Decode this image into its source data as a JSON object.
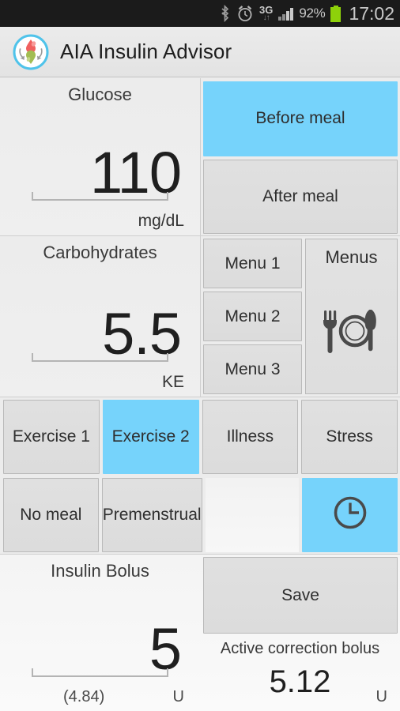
{
  "statusbar": {
    "icons": [
      "bluetooth-icon",
      "alarm-icon",
      "3g-icon",
      "signal-icon",
      "battery-icon"
    ],
    "network_label": "3G",
    "battery_percent": "92%",
    "clock": "17:02"
  },
  "titlebar": {
    "app_name": "AIA Insulin Advisor",
    "icon": "aia-app-logo"
  },
  "glucose": {
    "label": "Glucose",
    "value": "110",
    "unit": "mg/dL"
  },
  "meal_state": {
    "before_label": "Before meal",
    "after_label": "After meal",
    "selected": "Before meal"
  },
  "carbohydrates": {
    "label": "Carbohydrates",
    "value": "5.5",
    "unit": "KE"
  },
  "menu_buttons": [
    {
      "label": "Menu 1"
    },
    {
      "label": "Menu 2"
    },
    {
      "label": "Menu 3"
    }
  ],
  "menus_panel": {
    "title": "Menus",
    "icon": "cutlery-icon"
  },
  "factor_row": [
    {
      "label": "Exercise 1",
      "selected": false
    },
    {
      "label": "Exercise 2",
      "selected": true
    },
    {
      "label": "Illness",
      "selected": false
    },
    {
      "label": "Stress",
      "selected": false
    }
  ],
  "state_row": [
    {
      "label": "No meal",
      "selected": false
    },
    {
      "label": "Premenstrual",
      "selected": false
    },
    {
      "label": "",
      "selected": false
    },
    {
      "label": "",
      "selected": true,
      "icon": "clock-icon"
    }
  ],
  "insulin_bolus": {
    "label": "Insulin Bolus",
    "value": "5",
    "computed": "(4.84)",
    "unit": "U"
  },
  "save": {
    "label": "Save"
  },
  "active_correction": {
    "label": "Active correction bolus",
    "value": "5.12",
    "unit": "U"
  },
  "colors": {
    "accent_selected": "#76d3fb",
    "button_face": "#dedede",
    "panel_bg": "#ececec",
    "status_bar": "#1b1b1b",
    "battery_green": "#8ed10a"
  }
}
